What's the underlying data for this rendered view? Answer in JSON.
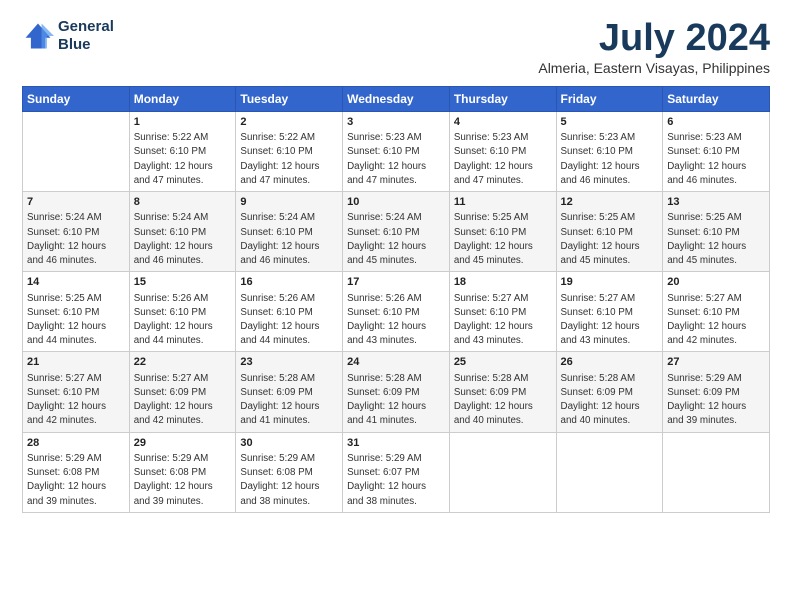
{
  "header": {
    "logo_line1": "General",
    "logo_line2": "Blue",
    "month_year": "July 2024",
    "location": "Almeria, Eastern Visayas, Philippines"
  },
  "days_of_week": [
    "Sunday",
    "Monday",
    "Tuesday",
    "Wednesday",
    "Thursday",
    "Friday",
    "Saturday"
  ],
  "weeks": [
    [
      {
        "num": "",
        "info": ""
      },
      {
        "num": "1",
        "info": "Sunrise: 5:22 AM\nSunset: 6:10 PM\nDaylight: 12 hours\nand 47 minutes."
      },
      {
        "num": "2",
        "info": "Sunrise: 5:22 AM\nSunset: 6:10 PM\nDaylight: 12 hours\nand 47 minutes."
      },
      {
        "num": "3",
        "info": "Sunrise: 5:23 AM\nSunset: 6:10 PM\nDaylight: 12 hours\nand 47 minutes."
      },
      {
        "num": "4",
        "info": "Sunrise: 5:23 AM\nSunset: 6:10 PM\nDaylight: 12 hours\nand 47 minutes."
      },
      {
        "num": "5",
        "info": "Sunrise: 5:23 AM\nSunset: 6:10 PM\nDaylight: 12 hours\nand 46 minutes."
      },
      {
        "num": "6",
        "info": "Sunrise: 5:23 AM\nSunset: 6:10 PM\nDaylight: 12 hours\nand 46 minutes."
      }
    ],
    [
      {
        "num": "7",
        "info": "Sunrise: 5:24 AM\nSunset: 6:10 PM\nDaylight: 12 hours\nand 46 minutes."
      },
      {
        "num": "8",
        "info": "Sunrise: 5:24 AM\nSunset: 6:10 PM\nDaylight: 12 hours\nand 46 minutes."
      },
      {
        "num": "9",
        "info": "Sunrise: 5:24 AM\nSunset: 6:10 PM\nDaylight: 12 hours\nand 46 minutes."
      },
      {
        "num": "10",
        "info": "Sunrise: 5:24 AM\nSunset: 6:10 PM\nDaylight: 12 hours\nand 45 minutes."
      },
      {
        "num": "11",
        "info": "Sunrise: 5:25 AM\nSunset: 6:10 PM\nDaylight: 12 hours\nand 45 minutes."
      },
      {
        "num": "12",
        "info": "Sunrise: 5:25 AM\nSunset: 6:10 PM\nDaylight: 12 hours\nand 45 minutes."
      },
      {
        "num": "13",
        "info": "Sunrise: 5:25 AM\nSunset: 6:10 PM\nDaylight: 12 hours\nand 45 minutes."
      }
    ],
    [
      {
        "num": "14",
        "info": "Sunrise: 5:25 AM\nSunset: 6:10 PM\nDaylight: 12 hours\nand 44 minutes."
      },
      {
        "num": "15",
        "info": "Sunrise: 5:26 AM\nSunset: 6:10 PM\nDaylight: 12 hours\nand 44 minutes."
      },
      {
        "num": "16",
        "info": "Sunrise: 5:26 AM\nSunset: 6:10 PM\nDaylight: 12 hours\nand 44 minutes."
      },
      {
        "num": "17",
        "info": "Sunrise: 5:26 AM\nSunset: 6:10 PM\nDaylight: 12 hours\nand 43 minutes."
      },
      {
        "num": "18",
        "info": "Sunrise: 5:27 AM\nSunset: 6:10 PM\nDaylight: 12 hours\nand 43 minutes."
      },
      {
        "num": "19",
        "info": "Sunrise: 5:27 AM\nSunset: 6:10 PM\nDaylight: 12 hours\nand 43 minutes."
      },
      {
        "num": "20",
        "info": "Sunrise: 5:27 AM\nSunset: 6:10 PM\nDaylight: 12 hours\nand 42 minutes."
      }
    ],
    [
      {
        "num": "21",
        "info": "Sunrise: 5:27 AM\nSunset: 6:10 PM\nDaylight: 12 hours\nand 42 minutes."
      },
      {
        "num": "22",
        "info": "Sunrise: 5:27 AM\nSunset: 6:09 PM\nDaylight: 12 hours\nand 42 minutes."
      },
      {
        "num": "23",
        "info": "Sunrise: 5:28 AM\nSunset: 6:09 PM\nDaylight: 12 hours\nand 41 minutes."
      },
      {
        "num": "24",
        "info": "Sunrise: 5:28 AM\nSunset: 6:09 PM\nDaylight: 12 hours\nand 41 minutes."
      },
      {
        "num": "25",
        "info": "Sunrise: 5:28 AM\nSunset: 6:09 PM\nDaylight: 12 hours\nand 40 minutes."
      },
      {
        "num": "26",
        "info": "Sunrise: 5:28 AM\nSunset: 6:09 PM\nDaylight: 12 hours\nand 40 minutes."
      },
      {
        "num": "27",
        "info": "Sunrise: 5:29 AM\nSunset: 6:09 PM\nDaylight: 12 hours\nand 39 minutes."
      }
    ],
    [
      {
        "num": "28",
        "info": "Sunrise: 5:29 AM\nSunset: 6:08 PM\nDaylight: 12 hours\nand 39 minutes."
      },
      {
        "num": "29",
        "info": "Sunrise: 5:29 AM\nSunset: 6:08 PM\nDaylight: 12 hours\nand 39 minutes."
      },
      {
        "num": "30",
        "info": "Sunrise: 5:29 AM\nSunset: 6:08 PM\nDaylight: 12 hours\nand 38 minutes."
      },
      {
        "num": "31",
        "info": "Sunrise: 5:29 AM\nSunset: 6:07 PM\nDaylight: 12 hours\nand 38 minutes."
      },
      {
        "num": "",
        "info": ""
      },
      {
        "num": "",
        "info": ""
      },
      {
        "num": "",
        "info": ""
      }
    ]
  ]
}
